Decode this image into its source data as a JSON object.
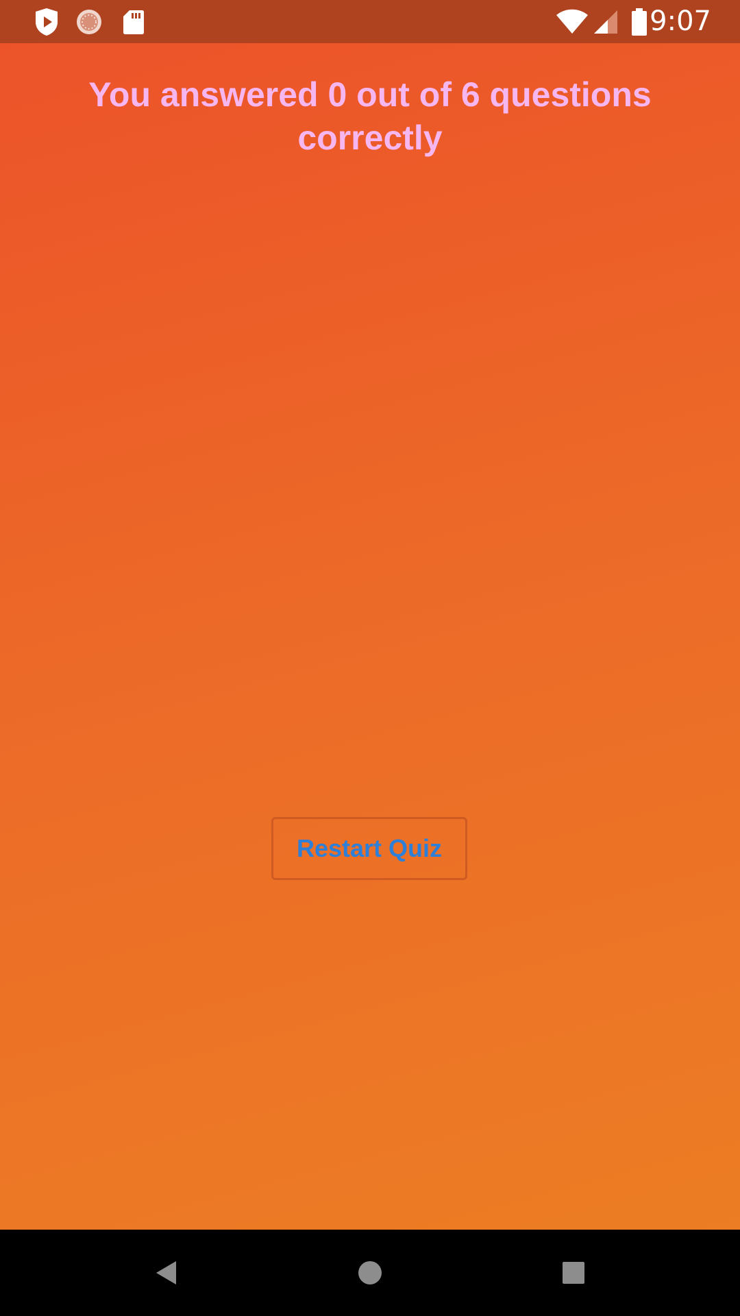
{
  "status_bar": {
    "time": "9:07",
    "left_icons": [
      "shield-play-icon",
      "loading-circle-icon",
      "sd-card-icon"
    ],
    "right_icons": [
      "wifi-icon",
      "signal-icon",
      "battery-icon"
    ]
  },
  "quiz_result": {
    "score_text": "You answered 0 out of 6 questions correctly",
    "restart_label": "Restart Quiz"
  },
  "nav_bar": {
    "icons": [
      "back-icon",
      "home-icon",
      "recents-icon"
    ]
  },
  "colors": {
    "status_bar_bg": "#af431f",
    "gradient_top": "#ec5329",
    "gradient_bottom": "#ec7d24",
    "score_text": "#f6b7f0",
    "button_text": "#2e7fd8",
    "button_border": "#cf5a22"
  }
}
